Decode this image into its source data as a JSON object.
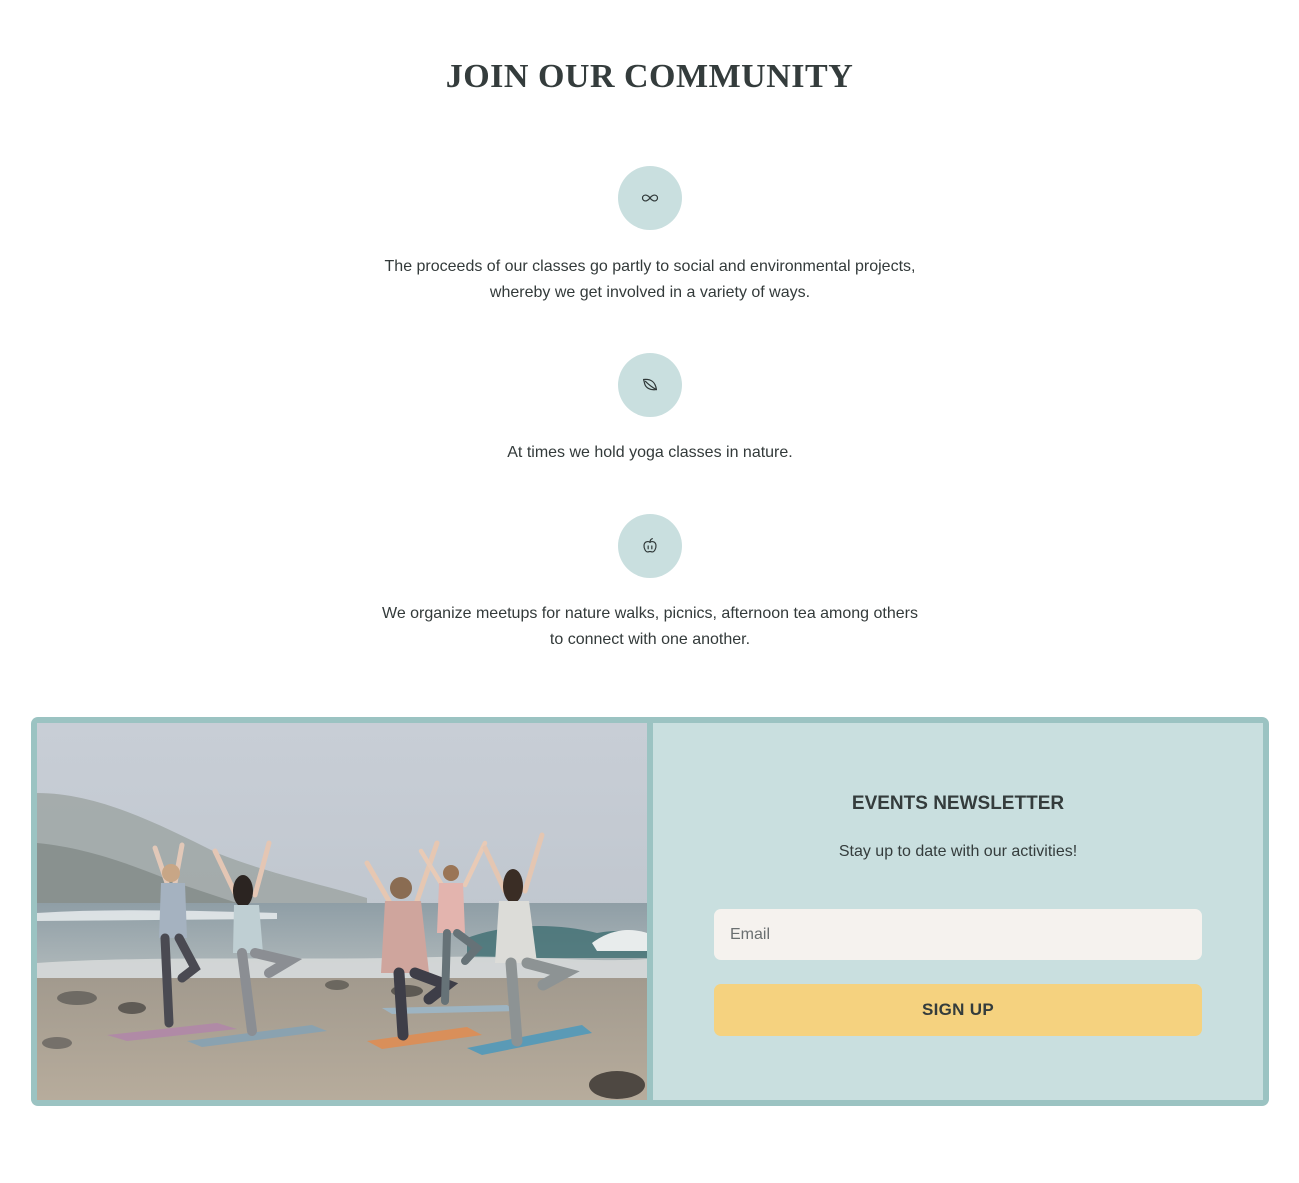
{
  "community": {
    "heading": "JOIN OUR COMMUNITY",
    "features": [
      {
        "icon": "infinity-icon",
        "lines": [
          "The proceeds of our classes go partly to social and environmental projects,",
          "whereby we get involved in a variety of ways."
        ]
      },
      {
        "icon": "leaf-icon",
        "lines": [
          "At times we hold yoga classes in nature."
        ]
      },
      {
        "icon": "apple-icon",
        "lines": [
          "We organize meetups for nature walks, picnics, afternoon tea among others",
          "to connect with one another."
        ]
      }
    ]
  },
  "newsletter": {
    "title": "EVENTS NEWSLETTER",
    "subtitle": "Stay up to date with our activities!",
    "email_placeholder": "Email",
    "email_value": "",
    "button_label": "SIGN UP"
  },
  "colors": {
    "icon_circle": "#c9dfdf",
    "panel_border": "#9bc3c2",
    "panel_bg": "#c9dfdf",
    "input_bg": "#f5f2ee",
    "button_bg": "#f5d27f",
    "heading_text": "#343c3c"
  },
  "photo": {
    "subject": "group doing tree pose yoga on a beach"
  }
}
